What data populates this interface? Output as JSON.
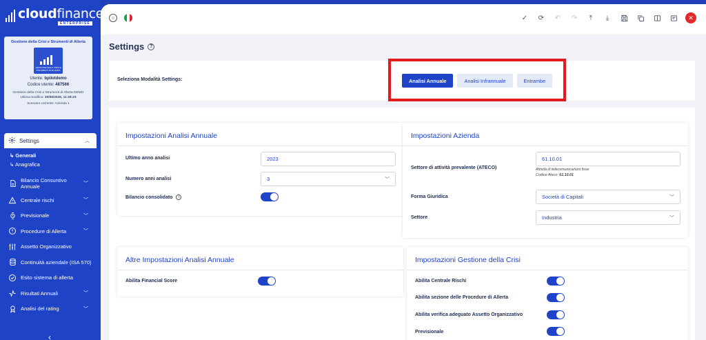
{
  "brand": {
    "name_bold": "cloud",
    "name_light": "finance",
    "edition": "ENTERPRISE"
  },
  "company_card": {
    "title": "Gestione della Crisi e Strumenti di Allerta",
    "logo_caption": "GESTIONE DELLA CRISI E STRUMENTI DI ALLERTA",
    "user_label": "Utente:",
    "user": "bpilotdemo",
    "code_label": "Codice utente:",
    "code": "487566",
    "company": "Gestione della Crisi e Strumenti di Allerta DEMO",
    "modified_label": "Ultima modifica:",
    "modified": "30/06/2025, 11:28:23",
    "scenario": "Scenario corrente: Azienda 1"
  },
  "nav": {
    "settings": "Settings",
    "sub": [
      "Generali",
      "Anagrafica"
    ],
    "items": [
      {
        "label": "Bilancio Consuntivo Annuale",
        "icon": "document-icon",
        "chevron": true
      },
      {
        "label": "Centrale rischi",
        "icon": "warning-icon",
        "chevron": true
      },
      {
        "label": "Previsionale",
        "icon": "watch-icon",
        "chevron": true
      },
      {
        "label": "Procedure di Allerta",
        "icon": "alert-circle-icon",
        "chevron": true
      },
      {
        "label": "Assetto Organizzativo",
        "icon": "sliders-icon",
        "chevron": false
      },
      {
        "label": "Continuità aziendale (ISA 570)",
        "icon": "database-icon",
        "chevron": false
      },
      {
        "label": "Esito sistema di allerta",
        "icon": "check-circle-icon",
        "chevron": false
      },
      {
        "label": "Risultati Annuali",
        "icon": "activity-icon",
        "chevron": true
      },
      {
        "label": "Analisi del rating",
        "icon": "medal-icon",
        "chevron": true
      }
    ]
  },
  "page": {
    "title": "Settings"
  },
  "mode": {
    "label": "Seleziona Modalità Settings:",
    "buttons": [
      "Analisi Annuale",
      "Analisi Infrannuale",
      "Entrambe"
    ],
    "active": "Analisi Annuale"
  },
  "annual": {
    "title": "Impostazioni Analisi Annuale",
    "last_year_label": "Ultimo anno analisi",
    "last_year": "2023",
    "num_years_label": "Numero anni analisi",
    "num_years": "3",
    "consolidated_label": "Bilancio consolidato"
  },
  "company": {
    "title": "Impostazioni Azienda",
    "ateco_label": "Settore di attività prevalente (ATECO)",
    "ateco": "61.10.01",
    "ateco_desc": "Attività di telecomunicazioni fisse",
    "ateco_code_label": "Codice Ateco:",
    "ateco_code": "61.10.01",
    "legal_form_label": "Forma Giuridica",
    "legal_form": "Società di Capitali",
    "sector_label": "Settore",
    "sector": "Industria"
  },
  "other": {
    "title": "Altre Impostazioni Analisi Annuale",
    "financial_score_label": "Abilita Financial Score"
  },
  "crisis": {
    "title": "Impostazioni Gestione della Crisi",
    "rows": [
      "Abilita Centrale Rischi",
      "Abilita sezione delle Procedure di Allerta",
      "Abilita verifica adeguato Assetto Organizzativo",
      "Previsionale"
    ]
  },
  "colors": {
    "accent": "#1f43c7",
    "highlight": "#e21b1b"
  }
}
